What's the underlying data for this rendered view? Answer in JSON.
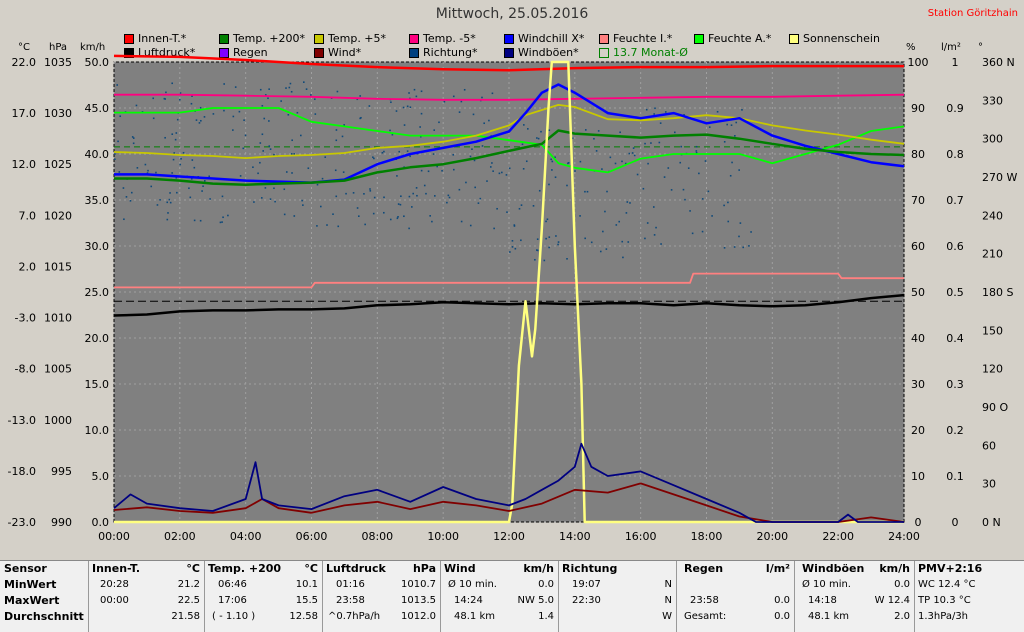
{
  "title": "Mittwoch, 25.05.2016",
  "station": "Station Göritzhain",
  "units": {
    "c": "°C",
    "hpa": "hPa",
    "kmh": "km/h",
    "pct": "%",
    "lm2": "l/m²",
    "deg": "°"
  },
  "legend": [
    {
      "label": "Innen-T.*",
      "color": "#ff0000"
    },
    {
      "label": "Temp. +200*",
      "color": "#008000"
    },
    {
      "label": "Temp. +5*",
      "color": "#c8c800"
    },
    {
      "label": "Temp. -5*",
      "color": "#ff0080"
    },
    {
      "label": "Windchill X*",
      "color": "#0000ff"
    },
    {
      "label": "Feuchte I.*",
      "color": "#ff8080"
    },
    {
      "label": "Feuchte A.*",
      "color": "#00ff00"
    },
    {
      "label": "Sonnenschein",
      "color": "#ffff80"
    },
    {
      "label": "Luftdruck*",
      "color": "#000000"
    },
    {
      "label": "Regen",
      "color": "#8000ff"
    },
    {
      "label": "Wind*",
      "color": "#800000"
    },
    {
      "label": "Richtung*",
      "color": "#004080"
    },
    {
      "label": "Windböen*",
      "color": "#000080"
    },
    {
      "label": "13.7 Monat-Ø",
      "color": "#008000",
      "hollow": true
    }
  ],
  "chart_data": {
    "type": "line",
    "x_ticks": [
      "00:00",
      "02:00",
      "04:00",
      "06:00",
      "08:00",
      "10:00",
      "12:00",
      "14:00",
      "16:00",
      "18:00",
      "20:00",
      "22:00",
      "24:00"
    ],
    "axis_temp": [
      "22.0",
      "17.0",
      "12.0",
      "7.0",
      "2.0",
      "-3.0",
      "-8.0",
      "-13.0",
      "-18.0",
      "-23.0"
    ],
    "axis_hpa": [
      "1035",
      "1030",
      "1025",
      "1020",
      "1015",
      "1010",
      "1005",
      "1000",
      "995",
      "990"
    ],
    "axis_kmh": [
      "50.0",
      "45.0",
      "40.0",
      "35.0",
      "30.0",
      "25.0",
      "20.0",
      "15.0",
      "10.0",
      "5.0",
      "0.0"
    ],
    "axis_pct": [
      "100",
      "90",
      "80",
      "70",
      "60",
      "50",
      "40",
      "30",
      "20",
      "10",
      "0"
    ],
    "axis_lm2": [
      "1",
      "0.9",
      "0.8",
      "0.7",
      "0.6",
      "0.5",
      "0.4",
      "0.3",
      "0.2",
      "0.1",
      "0"
    ],
    "axis_deg": [
      "360 N",
      "330",
      "300",
      "270 W",
      "240",
      "210",
      "180 S",
      "150",
      "120",
      "90 O",
      "60",
      "30",
      "0 N"
    ],
    "temp_range": [
      -23,
      22
    ],
    "kmh_range": [
      0,
      50
    ],
    "hpa_range": [
      990,
      1035
    ],
    "pct_range": [
      0,
      100
    ],
    "deg_range": [
      0,
      360
    ],
    "monthly_avg_temp": 13.7,
    "series": [
      {
        "name": "Innen-T.*",
        "color": "#ff0000",
        "axis": "temp",
        "points": [
          [
            0,
            22.6
          ],
          [
            2,
            22.5
          ],
          [
            4,
            22.2
          ],
          [
            6,
            21.8
          ],
          [
            8,
            21.5
          ],
          [
            10,
            21.3
          ],
          [
            12,
            21.2
          ],
          [
            14,
            21.4
          ],
          [
            16,
            21.5
          ],
          [
            18,
            21.5
          ],
          [
            20,
            21.6
          ],
          [
            22,
            21.6
          ],
          [
            24,
            21.6
          ]
        ]
      },
      {
        "name": "Temp. -5*",
        "color": "#ff0080",
        "axis": "temp",
        "points": [
          [
            0,
            18.8
          ],
          [
            2,
            18.8
          ],
          [
            4,
            18.7
          ],
          [
            6,
            18.6
          ],
          [
            8,
            18.4
          ],
          [
            10,
            18.3
          ],
          [
            12,
            18.3
          ],
          [
            14,
            18.4
          ],
          [
            16,
            18.5
          ],
          [
            18,
            18.6
          ],
          [
            20,
            18.6
          ],
          [
            22,
            18.7
          ],
          [
            24,
            18.8
          ]
        ]
      },
      {
        "name": "Feuchte A.*",
        "color": "#00ff00",
        "axis": "pct",
        "points": [
          [
            0,
            89
          ],
          [
            1,
            89
          ],
          [
            2,
            89
          ],
          [
            3,
            90
          ],
          [
            4,
            90
          ],
          [
            5,
            90
          ],
          [
            6,
            87
          ],
          [
            7,
            86
          ],
          [
            8,
            85
          ],
          [
            9,
            84
          ],
          [
            10,
            84
          ],
          [
            11,
            84
          ],
          [
            12,
            83
          ],
          [
            13,
            82
          ],
          [
            13.5,
            78
          ],
          [
            14,
            77
          ],
          [
            15,
            76
          ],
          [
            16,
            79
          ],
          [
            17,
            80
          ],
          [
            18,
            80
          ],
          [
            19,
            80
          ],
          [
            20,
            78
          ],
          [
            21,
            80
          ],
          [
            22,
            82
          ],
          [
            23,
            85
          ],
          [
            24,
            86
          ]
        ]
      },
      {
        "name": "Temp. +5*",
        "color": "#c8c800",
        "axis": "temp",
        "points": [
          [
            0,
            13.2
          ],
          [
            1,
            13.1
          ],
          [
            2,
            12.9
          ],
          [
            3,
            12.8
          ],
          [
            4,
            12.6
          ],
          [
            5,
            12.8
          ],
          [
            6,
            12.9
          ],
          [
            7,
            13.1
          ],
          [
            8,
            13.6
          ],
          [
            9,
            13.8
          ],
          [
            10,
            14.2
          ],
          [
            11,
            14.8
          ],
          [
            12,
            15.8
          ],
          [
            12.5,
            16.8
          ],
          [
            13,
            17.3
          ],
          [
            13.5,
            17.8
          ],
          [
            14,
            17.6
          ],
          [
            15,
            16.4
          ],
          [
            16,
            16.3
          ],
          [
            17,
            16.5
          ],
          [
            18,
            16.8
          ],
          [
            19,
            16.5
          ],
          [
            20,
            15.8
          ],
          [
            21,
            15.3
          ],
          [
            22,
            14.9
          ],
          [
            23,
            14.4
          ],
          [
            24,
            14.0
          ]
        ]
      },
      {
        "name": "Windchill X*",
        "color": "#0000ff",
        "axis": "temp",
        "points": [
          [
            0,
            11.0
          ],
          [
            1,
            11.0
          ],
          [
            2,
            10.8
          ],
          [
            3,
            10.6
          ],
          [
            4,
            10.4
          ],
          [
            5,
            10.3
          ],
          [
            6,
            10.2
          ],
          [
            7,
            10.5
          ],
          [
            8,
            12.0
          ],
          [
            9,
            13.0
          ],
          [
            10,
            13.6
          ],
          [
            11,
            14.2
          ],
          [
            12,
            15.2
          ],
          [
            12.5,
            17.0
          ],
          [
            13,
            19.0
          ],
          [
            13.5,
            19.8
          ],
          [
            14,
            19.0
          ],
          [
            15,
            17.0
          ],
          [
            16,
            16.5
          ],
          [
            17,
            17.0
          ],
          [
            18,
            16.0
          ],
          [
            19,
            16.5
          ],
          [
            20,
            14.8
          ],
          [
            21,
            13.8
          ],
          [
            22,
            13.0
          ],
          [
            23,
            12.2
          ],
          [
            24,
            11.8
          ]
        ]
      },
      {
        "name": "Temp. +200*",
        "color": "#008000",
        "axis": "temp",
        "points": [
          [
            0,
            10.6
          ],
          [
            1,
            10.6
          ],
          [
            2,
            10.4
          ],
          [
            3,
            10.1
          ],
          [
            4,
            10.0
          ],
          [
            5,
            10.1
          ],
          [
            6,
            10.2
          ],
          [
            7,
            10.4
          ],
          [
            8,
            11.2
          ],
          [
            9,
            11.7
          ],
          [
            10,
            12.0
          ],
          [
            11,
            12.6
          ],
          [
            12,
            13.3
          ],
          [
            13,
            14.0
          ],
          [
            13.5,
            15.3
          ],
          [
            14,
            15.0
          ],
          [
            15,
            14.8
          ],
          [
            16,
            14.6
          ],
          [
            17,
            14.8
          ],
          [
            18,
            14.9
          ],
          [
            19,
            14.5
          ],
          [
            20,
            14.0
          ],
          [
            21,
            13.5
          ],
          [
            22,
            13.2
          ],
          [
            23,
            13.0
          ],
          [
            24,
            12.9
          ]
        ]
      },
      {
        "name": "Feuchte I.*",
        "color": "#ff8080",
        "axis": "pct",
        "points": [
          [
            0,
            51
          ],
          [
            2,
            51
          ],
          [
            4,
            51
          ],
          [
            6,
            51
          ],
          [
            6.1,
            52
          ],
          [
            8,
            52
          ],
          [
            10,
            52
          ],
          [
            12,
            52
          ],
          [
            14,
            52
          ],
          [
            16,
            52
          ],
          [
            17.5,
            52
          ],
          [
            17.6,
            54
          ],
          [
            20,
            54
          ],
          [
            22,
            54
          ],
          [
            22.1,
            53
          ],
          [
            24,
            53
          ]
        ]
      },
      {
        "name": "Luftdruck*",
        "color": "#000000",
        "axis": "hpa",
        "points": [
          [
            0,
            1010.2
          ],
          [
            1,
            1010.3
          ],
          [
            2,
            1010.6
          ],
          [
            3,
            1010.7
          ],
          [
            4,
            1010.7
          ],
          [
            5,
            1010.8
          ],
          [
            6,
            1010.8
          ],
          [
            7,
            1010.9
          ],
          [
            8,
            1011.2
          ],
          [
            9,
            1011.3
          ],
          [
            10,
            1011.5
          ],
          [
            11,
            1011.4
          ],
          [
            12,
            1011.3
          ],
          [
            13,
            1011.4
          ],
          [
            14,
            1011.3
          ],
          [
            15,
            1011.4
          ],
          [
            16,
            1011.4
          ],
          [
            17,
            1011.2
          ],
          [
            18,
            1011.4
          ],
          [
            19,
            1011.2
          ],
          [
            20,
            1011.1
          ],
          [
            21,
            1011.2
          ],
          [
            22,
            1011.5
          ],
          [
            23,
            1011.9
          ],
          [
            24,
            1012.2
          ]
        ]
      },
      {
        "name": "Sonnenschein",
        "color": "#ffff80",
        "axis": "kmh",
        "points": [
          [
            0,
            0
          ],
          [
            12,
            0
          ],
          [
            12.1,
            2
          ],
          [
            12.3,
            17
          ],
          [
            12.5,
            24
          ],
          [
            12.7,
            18
          ],
          [
            12.8,
            21
          ],
          [
            13,
            32
          ],
          [
            13.2,
            45
          ],
          [
            13.3,
            50
          ],
          [
            13.8,
            50
          ],
          [
            14,
            30
          ],
          [
            14.2,
            15
          ],
          [
            14.3,
            0
          ],
          [
            24,
            0
          ]
        ]
      },
      {
        "name": "Wind*",
        "color": "#800000",
        "axis": "kmh",
        "points": [
          [
            0,
            1.3
          ],
          [
            1,
            1.6
          ],
          [
            2,
            1.2
          ],
          [
            3,
            1.0
          ],
          [
            4,
            1.5
          ],
          [
            4.5,
            2.5
          ],
          [
            5,
            1.5
          ],
          [
            6,
            1.0
          ],
          [
            7,
            1.8
          ],
          [
            8,
            2.2
          ],
          [
            9,
            1.4
          ],
          [
            10,
            2.2
          ],
          [
            11,
            1.8
          ],
          [
            12,
            1.2
          ],
          [
            13,
            2.0
          ],
          [
            14,
            3.5
          ],
          [
            15,
            3.2
          ],
          [
            16,
            4.2
          ],
          [
            17,
            3.0
          ],
          [
            18,
            1.8
          ],
          [
            19,
            0.6
          ],
          [
            20,
            0
          ],
          [
            22,
            0
          ],
          [
            23,
            0.5
          ],
          [
            24,
            0
          ]
        ]
      },
      {
        "name": "Windböen*",
        "color": "#000080",
        "axis": "kmh",
        "points": [
          [
            0,
            1.5
          ],
          [
            0.5,
            3.0
          ],
          [
            1,
            2.0
          ],
          [
            2,
            1.5
          ],
          [
            3,
            1.2
          ],
          [
            4,
            2.5
          ],
          [
            4.3,
            6.5
          ],
          [
            4.5,
            2.5
          ],
          [
            5,
            1.8
          ],
          [
            6,
            1.4
          ],
          [
            7,
            2.8
          ],
          [
            8,
            3.5
          ],
          [
            9,
            2.2
          ],
          [
            10,
            3.8
          ],
          [
            11,
            2.5
          ],
          [
            12,
            1.8
          ],
          [
            12.5,
            2.5
          ],
          [
            13,
            3.5
          ],
          [
            13.5,
            4.5
          ],
          [
            14,
            6.0
          ],
          [
            14.2,
            8.5
          ],
          [
            14.5,
            6.0
          ],
          [
            15,
            5.0
          ],
          [
            16,
            5.5
          ],
          [
            17,
            4.0
          ],
          [
            18,
            2.5
          ],
          [
            19,
            1.0
          ],
          [
            19.5,
            0
          ],
          [
            22,
            0
          ],
          [
            22.3,
            0.8
          ],
          [
            22.6,
            0
          ],
          [
            24,
            0
          ]
        ]
      }
    ],
    "wind_direction_scatter": "dots in axis_deg scale"
  },
  "stats": {
    "labels": {
      "sensor": "Sensor",
      "min": "MinWert",
      "max": "MaxWert",
      "avg": "Durchschnitt"
    },
    "innen": {
      "h": "Innen-T.",
      "u": "°C",
      "min_t": "20:28",
      "min_v": "21.2",
      "max_t": "00:00",
      "max_v": "22.5",
      "avg": "21.58"
    },
    "temp": {
      "h": "Temp. +200",
      "u": "°C",
      "min_t": "06:46",
      "min_v": "10.1",
      "max_t": "17:06",
      "max_v": "15.5",
      "avg_t": "( - 1.10 )",
      "avg": "12.58"
    },
    "druck": {
      "h": "Luftdruck",
      "u": "hPa",
      "min_t": "01:16",
      "min_v": "1010.7",
      "max_t": "23:58",
      "max_v": "1013.5",
      "avg_t": "^0.7hPa/h",
      "avg": "1012.0"
    },
    "wind": {
      "h": "Wind",
      "u": "km/h",
      "min_t": "Ø 10 min.",
      "min_v": "0.0",
      "max_t": "14:24",
      "max_v": "NW 5.0",
      "avg_t": "48.1 km",
      "avg": "1.4"
    },
    "richtung": {
      "h": "Richtung",
      "min_t": "19:07",
      "min_v": "N",
      "max_t": "22:30",
      "max_v": "N",
      "avg": "W"
    },
    "regen": {
      "h": "Regen",
      "u": "l/m²",
      "max_t": "23:58",
      "max_v": "0.0",
      "avg_t": "Gesamt:",
      "avg": "0.0"
    },
    "boeen": {
      "h": "Windböen",
      "u": "km/h",
      "min_t": "Ø 10 min.",
      "min_v": "0.0",
      "max_t": "14:18",
      "max_v": "W 12.4",
      "avg_t": "48.1 km",
      "avg": "2.0"
    },
    "pmv": {
      "h": "PMV+2:16",
      "min_v": "WC 12.4 °C",
      "max_v": "TP 10.3 °C",
      "avg": "1.3hPa/3h"
    }
  }
}
